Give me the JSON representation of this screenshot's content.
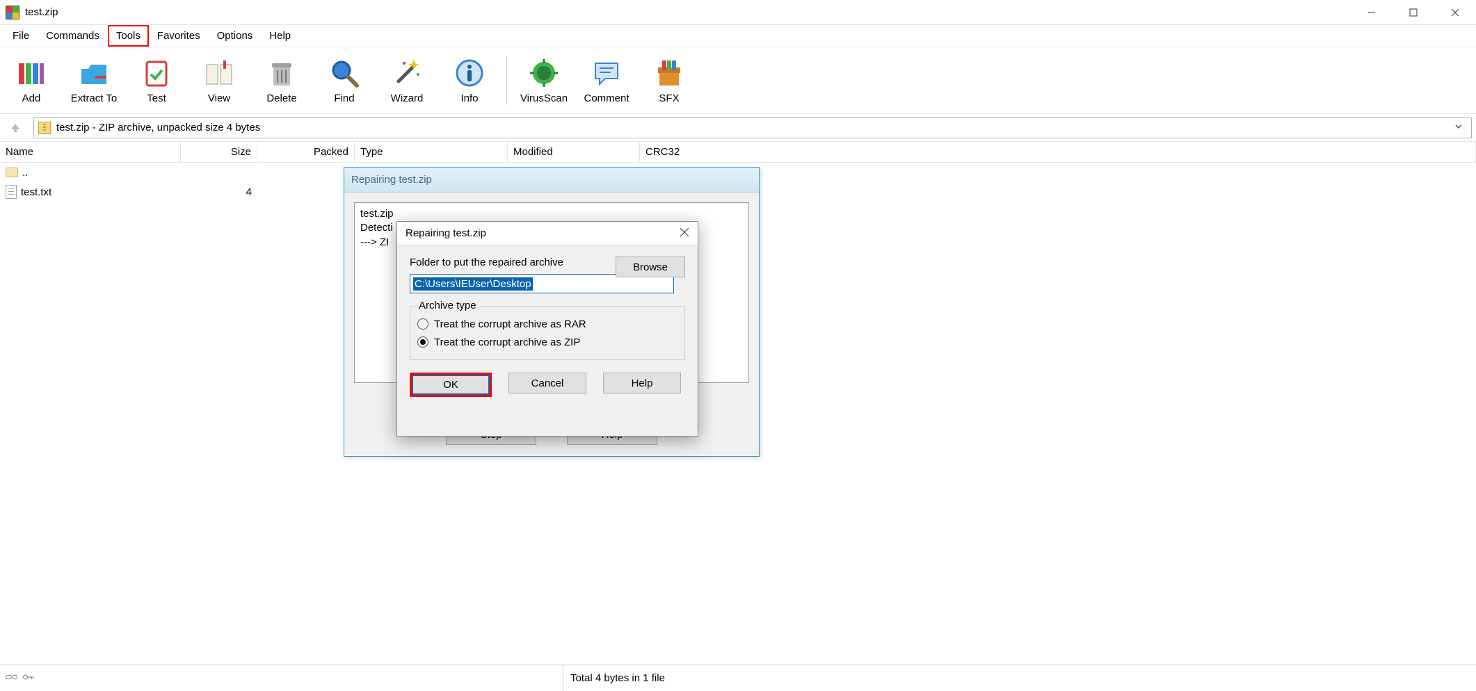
{
  "window": {
    "title": "test.zip"
  },
  "menu": {
    "file": "File",
    "commands": "Commands",
    "tools": "Tools",
    "favorites": "Favorites",
    "options": "Options",
    "help": "Help"
  },
  "toolbar": {
    "add": "Add",
    "extract": "Extract To",
    "test": "Test",
    "view": "View",
    "delete": "Delete",
    "find": "Find",
    "wizard": "Wizard",
    "info": "Info",
    "virusscan": "VirusScan",
    "comment": "Comment",
    "sfx": "SFX"
  },
  "address": {
    "text": "test.zip - ZIP archive, unpacked size 4 bytes"
  },
  "columns": {
    "name": "Name",
    "size": "Size",
    "packed": "Packed",
    "type": "Type",
    "modified": "Modified",
    "crc": "CRC32"
  },
  "rows": {
    "updir": "..",
    "file1_name": "test.txt",
    "file1_size": "4"
  },
  "status": {
    "total": "Total 4 bytes in 1 file"
  },
  "progress_dialog": {
    "title": "Repairing test.zip",
    "log_line1": "test.zip",
    "log_line2": "Detecti",
    "log_line3": "---> ZI",
    "stop": "Stop",
    "help": "Help"
  },
  "repair_dialog": {
    "title": "Repairing test.zip",
    "folder_label": "Folder to put the repaired archive",
    "browse": "Browse",
    "path": "C:\\Users\\IEUser\\Desktop",
    "group_label": "Archive type",
    "radio_rar": "Treat the corrupt archive as RAR",
    "radio_zip": "Treat the corrupt archive as ZIP",
    "ok": "OK",
    "cancel": "Cancel",
    "help": "Help"
  }
}
